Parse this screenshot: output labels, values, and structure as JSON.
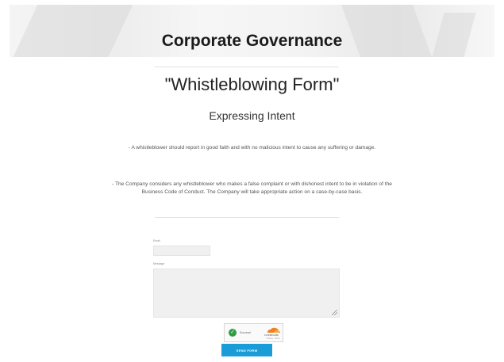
{
  "header": {
    "title": "Corporate Governance"
  },
  "form": {
    "title": "\"Whistleblowing Form\"",
    "subtitle": "Expressing Intent",
    "paragraph1": "- A whistleblower should report in good faith and with no malicious intent to cause any suffering or damage.",
    "paragraph2": "- The Company considers any whistleblower who makes a false complaint or with dishonest intent to be in violation of the Business Code of Conduct. The Company will take appropriate action on a case-by-case basis.",
    "email_label": "Email",
    "message_label": "Message",
    "captcha": {
      "status": "Success!",
      "brand": "CLOUDFLARE",
      "privacy": "Privacy",
      "terms": "Terms"
    },
    "submit_label": "SEND FORM"
  },
  "colors": {
    "accent": "#1a9cd8",
    "success": "#2e9e44",
    "cloudflare": "#f38020"
  },
  "icons": [
    "check-icon",
    "cloudflare-logo",
    "resize-handle-icon"
  ]
}
